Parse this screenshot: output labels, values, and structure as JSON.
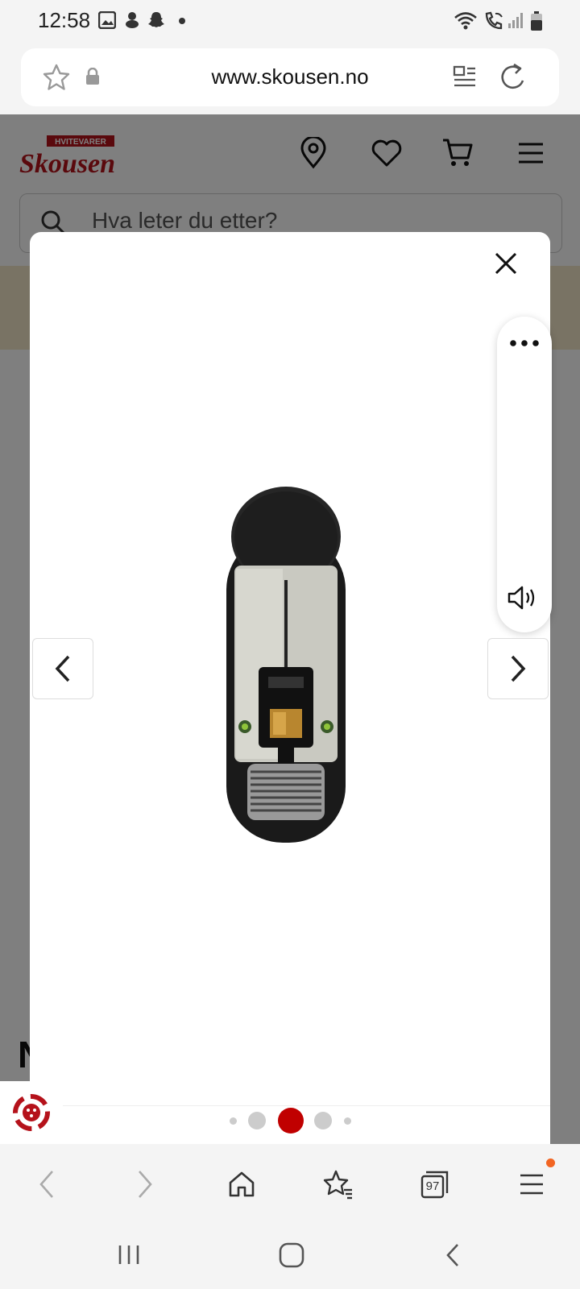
{
  "status_bar": {
    "time": "12:58",
    "icons": [
      "gallery-icon",
      "notification-icon",
      "snapchat-icon",
      "dot-icon",
      "wifi-icon",
      "wifi-calling-icon",
      "signal-icon",
      "battery-icon"
    ]
  },
  "browser": {
    "url": "www.skousen.no",
    "tab_count": "97"
  },
  "site": {
    "logo_tagline": "HVITEVARER",
    "logo_text": "Skousen",
    "search_placeholder": "Hva leter du etter?",
    "heading_fragment": "N"
  },
  "gallery": {
    "total_dots": 5,
    "active_index": 2
  },
  "colors": {
    "brand_red": "#b5121b",
    "active_dot": "#c00000",
    "notification_dot": "#f26522"
  }
}
